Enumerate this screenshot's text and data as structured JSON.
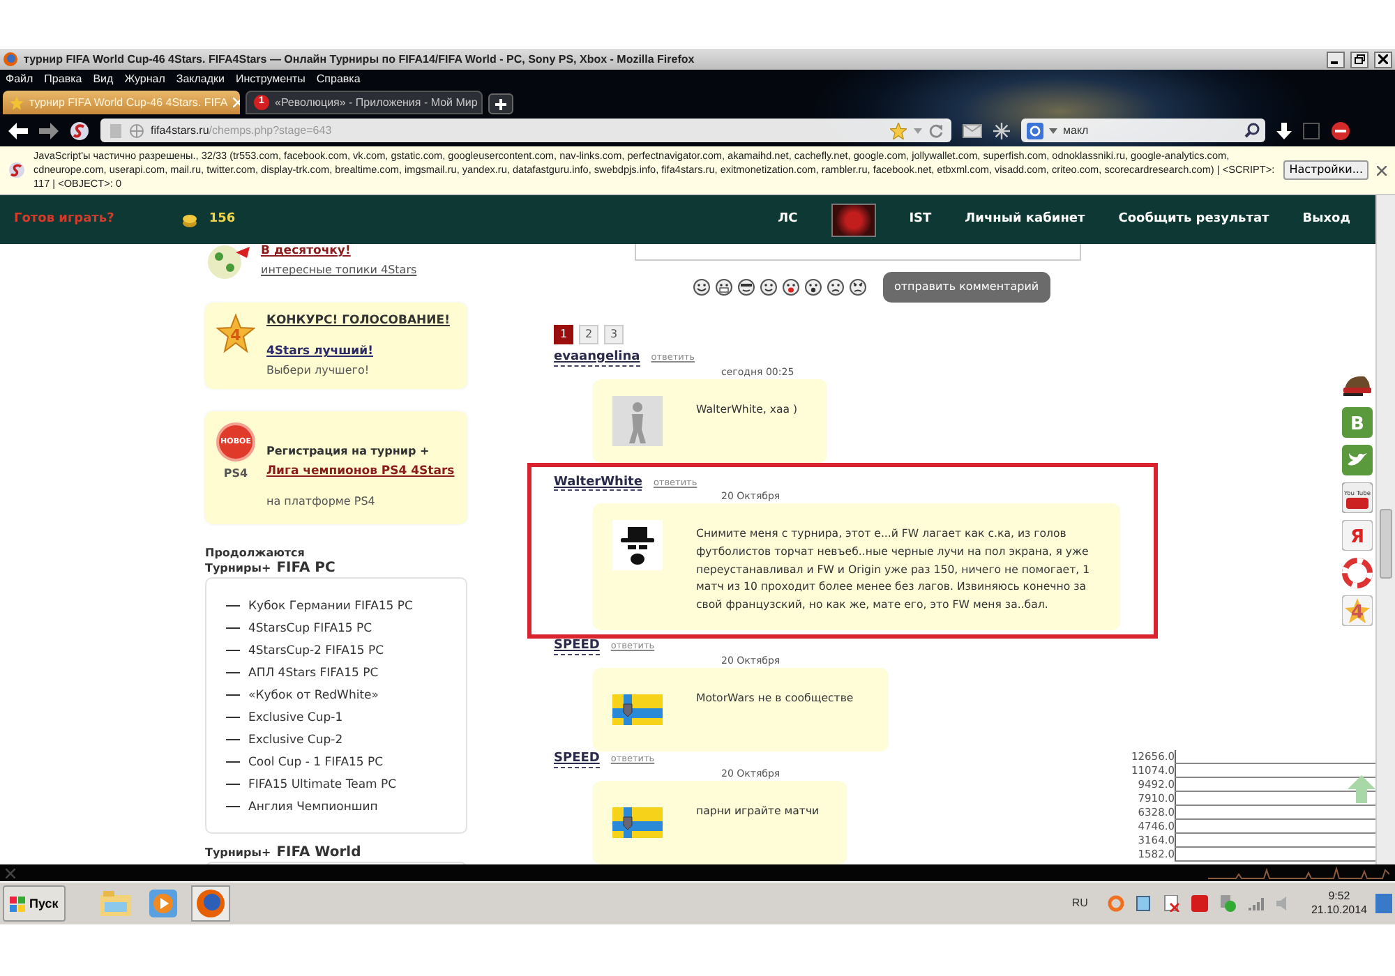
{
  "window": {
    "title": "турнир FIFA World Cup-46 4Stars. FIFA4Stars — Онлайн Турниры по FIFA14/FIFA World - PC, Sony PS, Xbox - Mozilla Firefox"
  },
  "menu": [
    "Файл",
    "Правка",
    "Вид",
    "Журнал",
    "Закладки",
    "Инструменты",
    "Справка"
  ],
  "tabs": [
    {
      "label": "турнир FIFA World Cup-46 4Stars. FIFA",
      "selected": true
    },
    {
      "label": "«Революция» - Приложения - Мой Мир",
      "selected": false,
      "badge": "1"
    }
  ],
  "address": {
    "domain": "fifa4stars.ru",
    "path": "/chemps.php?stage=643"
  },
  "search": {
    "value": "макл"
  },
  "notification": {
    "message": "JavaScript'ы частично разрешены., 32/33 (tr553.com, facebook.com, vk.com, gstatic.com, googleusercontent.com, nav-links.com, perfectnavigator.com, akamaihd.net, cachefly.net, google.com, jollywallet.com, superfish.com, odnoklassniki.ru, google-analytics.com, cdneurope.com, userapi.com, mail.ru, twitter.com, display-trk.com, brealtime.com, imgsmail.ru, yandex.ru, datafastguru.info, swebdpjs.info, fifa4stars.ru, exitmonetization.com, rambler.ru, facebook.net, etbxml.com, visadd.com, criteo.com, scorecardresearch.com) | <SCRIPT>: 117 | <OBJECT>: 0",
    "button": "Настройки..."
  },
  "site_header": {
    "tagline": "Готов играть?",
    "coins": "156",
    "nav": [
      {
        "kind": "link",
        "label": "ЛС"
      },
      {
        "kind": "avatar"
      },
      {
        "kind": "link",
        "label": "IST"
      },
      {
        "kind": "link",
        "label": "Личный кабинет"
      },
      {
        "kind": "link",
        "label": "Сообщить результат"
      },
      {
        "kind": "link",
        "label": "Выход"
      }
    ]
  },
  "sidebar": {
    "promos": [
      {
        "kind": "ball",
        "title": "В десяточку!",
        "subtitle": "интересные топики 4Stars"
      },
      {
        "kind": "star",
        "star_label": "4",
        "title": "КОНКУРС! ГОЛОСОВАНИЕ!",
        "link": "4Stars лучший!",
        "subtitle": "Выбери лучшего!"
      },
      {
        "kind": "ps4",
        "badge": "НОВОЕ",
        "logo": "PS4",
        "title": "Регистрация на турнир +",
        "link": "Лига чемпионов PS4 4Stars",
        "subtitle": "на платформе PS4"
      }
    ],
    "section_title": "Продолжаются",
    "groups": [
      {
        "prefix": "Турниры+",
        "name": "FIFA PC",
        "items": [
          "Кубок Германии FIFA15 PC",
          "4StarsCup FIFA15 PC",
          "4StarsCup-2 FIFA15 PC",
          "АПЛ 4Stars FIFA15 PC",
          "«Кубок от RedWhite»",
          "Exclusive Cup-1",
          "Exclusive Cup-2",
          "Cool Cup - 1 FIFA15 PC",
          "FIFA15 Ultimate Team PC",
          "Англия Чемпионшип"
        ]
      },
      {
        "prefix": "Турниры+",
        "name": "FIFA World"
      }
    ]
  },
  "comment_form": {
    "emoticons": [
      {
        "kind": "smile"
      },
      {
        "kind": "grin"
      },
      {
        "kind": "cool"
      },
      {
        "kind": "wink"
      },
      {
        "kind": "tongue"
      },
      {
        "kind": "surprised"
      },
      {
        "kind": "sad"
      },
      {
        "kind": "angry"
      }
    ],
    "submit": "отправить комментарий"
  },
  "pagination": [
    {
      "label": "1",
      "selected": true
    },
    {
      "label": "2",
      "selected": false
    },
    {
      "label": "3",
      "selected": false
    }
  ],
  "comments": [
    {
      "author": "evaangelina",
      "reply": "ответить",
      "date": "сегодня 00:25",
      "kind": "player",
      "text": "WalterWhite, хаа )",
      "highlighted": false
    },
    {
      "author": "WalterWhite",
      "reply": "ответить",
      "date": "20 Октября",
      "kind": "hat",
      "text": "Снимите меня с турнира, этот е...й FW лагает как с.ка, из голов футболистов торчат невъеб..ные черные лучи на пол экрана, я уже переустанавливал и FW и Origin уже раз 150, ничего не помогает, 1 матч из 10 проходит более менее без лагов. Извиняюсь конечно за свой французский, но как же, мате его, это FW меня за..бал.",
      "highlighted": true
    },
    {
      "author": "SPEED",
      "reply": "ответить",
      "date": "20 Октября",
      "kind": "flag",
      "text": "MotorWars не в сообществе",
      "highlighted": false
    },
    {
      "author": "SPEED",
      "reply": "ответить",
      "date": "20 Октября",
      "kind": "flag",
      "text": "парни играйте матчи",
      "highlighted": false
    }
  ],
  "social": [
    {
      "kind": "cap"
    },
    {
      "kind": "vk",
      "glyph": "B"
    },
    {
      "kind": "twitter"
    },
    {
      "kind": "youtube",
      "glyph": "You Tube"
    },
    {
      "kind": "yandex",
      "glyph": "Я"
    },
    {
      "kind": "ring"
    },
    {
      "kind": "star",
      "glyph": "4"
    }
  ],
  "graph": {
    "tick_labels": [
      "12656.0",
      "11074.0",
      "9492.0",
      "7910.0",
      "6328.0",
      "4746.0",
      "3164.0",
      "1582.0"
    ]
  },
  "taskbar": {
    "start": "Пуск",
    "language": "RU",
    "time": "9:52",
    "date": "21.10.2014"
  }
}
